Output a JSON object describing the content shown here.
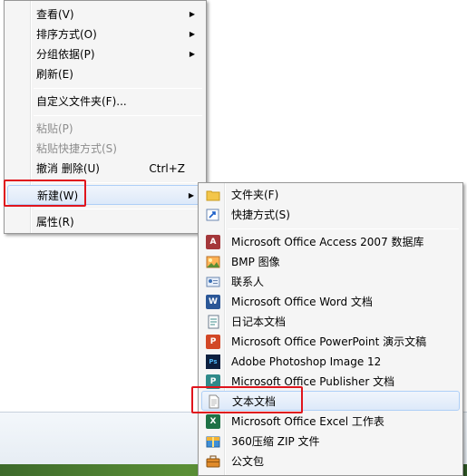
{
  "context_menu": {
    "view": "查看(V)",
    "sort_by": "排序方式(O)",
    "group_by": "分组依据(P)",
    "refresh": "刷新(E)",
    "customize_folder": "自定义文件夹(F)...",
    "paste": "粘贴(P)",
    "paste_shortcut": "粘贴快捷方式(S)",
    "undo_delete": "撤消 删除(U)",
    "undo_shortcut": "Ctrl+Z",
    "new": "新建(W)",
    "properties": "属性(R)"
  },
  "new_submenu": {
    "folder": "文件夹(F)",
    "shortcut": "快捷方式(S)",
    "access_db": "Microsoft Office Access 2007 数据库",
    "bmp_image": "BMP 图像",
    "contact": "联系人",
    "word_doc": "Microsoft Office Word 文档",
    "journal_doc": "日记本文档",
    "powerpoint": "Microsoft Office PowerPoint 演示文稿",
    "photoshop": "Adobe Photoshop Image 12",
    "publisher": "Microsoft Office Publisher 文档",
    "text_doc": "文本文档",
    "excel": "Microsoft Office Excel 工作表",
    "zip_360": "360压缩 ZIP 文件",
    "briefcase": "公文包"
  },
  "icons": {
    "submenu_arrow": "▶",
    "access": "A",
    "word": "W",
    "powerpoint": "P",
    "photoshop": "Ps",
    "publisher": "P",
    "excel": "X"
  },
  "colors": {
    "highlight_border": "#e0151d",
    "hover_fill": "#dde9f9"
  }
}
